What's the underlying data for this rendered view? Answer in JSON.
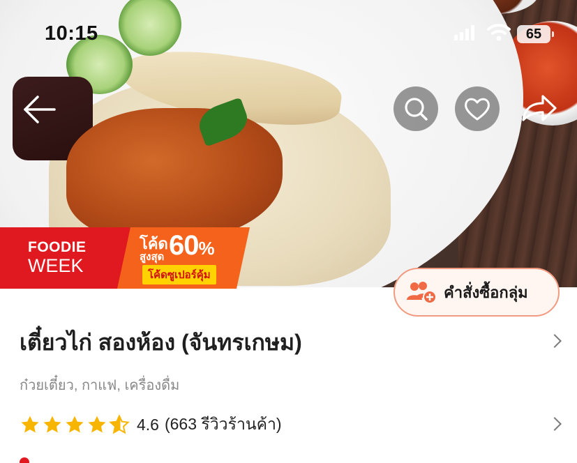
{
  "status_bar": {
    "time": "10:15",
    "battery": "65"
  },
  "promo": {
    "line1": "FOODIE",
    "line2": "WEEK",
    "code_label": "โค้ด",
    "up_to": "สูงสุด",
    "percent": "60",
    "percent_sign": "%",
    "super_code": "โค้ดซูเปอร์คุ้ม",
    "colors": {
      "red": "#e0181f",
      "orange": "#f5621b",
      "yellow": "#ffd200"
    }
  },
  "group_order": {
    "label": "คำสั่งซื้อกลุ่ม"
  },
  "shop": {
    "name": "เตี๋ยวไก่ สองห้อง (จันทรเกษม)",
    "categories": "ก๋วยเตี๋ยว, กาแฟ, เครื่องดื่ม",
    "rating_value": 4.6,
    "rating": "4.6",
    "reviews_text": "(663 รีวิวร้านค้า)"
  },
  "icons": {
    "back": "arrow-left-icon",
    "search": "search-icon",
    "favorite": "heart-icon",
    "share": "share-icon",
    "group": "group-add-icon",
    "star": "star-icon"
  },
  "accent_color": "#ef6a45"
}
